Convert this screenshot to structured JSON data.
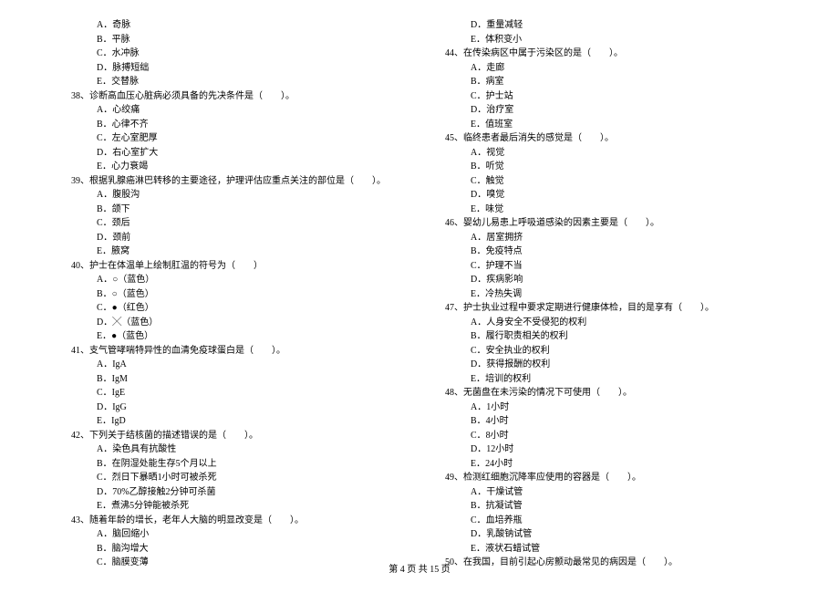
{
  "left_column": {
    "intro_options": [
      "A．奇脉",
      "B．平脉",
      "C．水冲脉",
      "D．脉搏短绌",
      "E．交替脉"
    ],
    "questions": [
      {
        "num": "38、",
        "text": "诊断高血压心脏病必须具备的先决条件是（　　）。",
        "options": [
          "A．心绞痛",
          "B．心律不齐",
          "C．左心室肥厚",
          "D．右心室扩大",
          "E．心力衰竭"
        ]
      },
      {
        "num": "39、",
        "text": "根据乳腺癌淋巴转移的主要途径，护理评估应重点关注的部位是（　　）。",
        "options": [
          "A．腹股沟",
          "B．颌下",
          "C．颈后",
          "D．颈前",
          "E．腋窝"
        ]
      },
      {
        "num": "40、",
        "text": "护士在体温单上绘制肛温的符号为（　　）",
        "options": [
          "A．○（蓝色）",
          "B．○（蓝色）",
          "C．●（红色）",
          "D．╳（蓝色）",
          "E．●（蓝色）"
        ]
      },
      {
        "num": "41、",
        "text": "支气管哮喘特异性的血清免疫球蛋白是（　　）。",
        "options": [
          "A．IgA",
          "B．IgM",
          "C．IgE",
          "D．IgG",
          "E．IgD"
        ]
      },
      {
        "num": "42、",
        "text": "下列关于结核菌的描述错误的是（　　）。",
        "options": [
          "A．染色具有抗酸性",
          "B．在阴湿处能生存5个月以上",
          "C．烈日下暴晒1小时可被杀死",
          "D．70%乙醇接触2分钟可杀菌",
          "E．煮沸5分钟能被杀死"
        ]
      },
      {
        "num": "43、",
        "text": "随着年龄的增长，老年人大脑的明显改变是（　　）。",
        "options": [
          "A．脑回缩小",
          "B．脑沟增大",
          "C．脑膜变薄"
        ]
      }
    ]
  },
  "right_column": {
    "intro_options": [
      "D．重量减轻",
      "E．体积变小"
    ],
    "questions": [
      {
        "num": "44、",
        "text": "在传染病区中属于污染区的是（　　）。",
        "options": [
          "A．走廊",
          "B．病室",
          "C．护士站",
          "D．治疗室",
          "E．值班室"
        ]
      },
      {
        "num": "45、",
        "text": "临终患者最后消失的感觉是（　　）。",
        "options": [
          "A．视觉",
          "B．听觉",
          "C．触觉",
          "D．嗅觉",
          "E．味觉"
        ]
      },
      {
        "num": "46、",
        "text": "婴幼儿易患上呼吸道感染的因素主要是（　　）。",
        "options": [
          "A．居室拥挤",
          "B．免疫特点",
          "C．护理不当",
          "D．疾病影响",
          "E．冷热失调"
        ]
      },
      {
        "num": "47、",
        "text": "护士执业过程中要求定期进行健康体检，目的是享有（　　）。",
        "options": [
          "A．人身安全不受侵犯的权利",
          "B．履行职责相关的权利",
          "C．安全执业的权利",
          "D．获得报酬的权利",
          "E．培训的权利"
        ]
      },
      {
        "num": "48、",
        "text": "无菌盘在未污染的情况下可使用（　　）。",
        "options": [
          "A．1小时",
          "B．4小时",
          "C．8小时­­",
          "D．12小时",
          "E．24小时"
        ]
      },
      {
        "num": "49、",
        "text": "检测红细胞沉降率应使用的容器是（　　）。",
        "options": [
          "A．干燥试管",
          "B．抗凝试管",
          "C．血培养瓶",
          "D．乳酸钠试管",
          "E．液状石蜡试管"
        ]
      },
      {
        "num": "50、",
        "text": "在我国，目前引起心房颤动最常见的病因是（　　）。",
        "options": []
      }
    ]
  },
  "footer": {
    "text": "第 4 页 共 15 页"
  }
}
